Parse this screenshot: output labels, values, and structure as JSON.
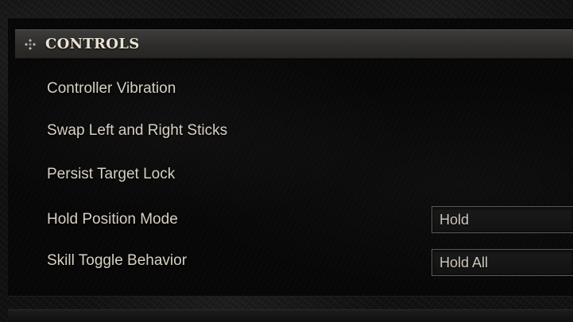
{
  "section": {
    "title": "CONTROLS",
    "icon": "diamond-cluster-icon"
  },
  "settings": [
    {
      "label": "Controller Vibration"
    },
    {
      "label": "Swap Left and Right Sticks"
    },
    {
      "label": "Persist Target Lock"
    },
    {
      "label": "Hold Position Mode",
      "value": "Hold"
    },
    {
      "label": "Skill Toggle Behavior",
      "value": "Hold All"
    }
  ],
  "colors": {
    "header_text": "#e9e2d3",
    "label_text": "#d7d1c4",
    "select_border": "#5d5b57",
    "background": "#080808"
  }
}
